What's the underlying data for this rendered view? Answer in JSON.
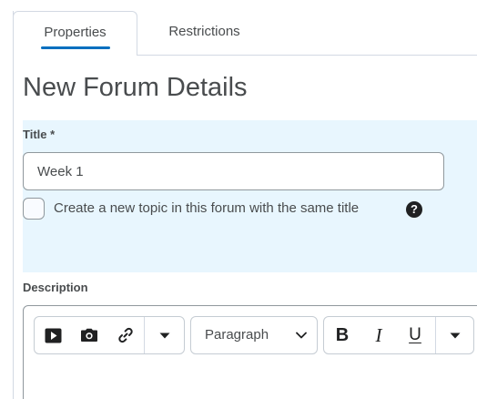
{
  "tabs": [
    {
      "label": "Properties",
      "active": true
    },
    {
      "label": "Restrictions",
      "active": false
    }
  ],
  "page_title": "New Forum Details",
  "title_field": {
    "label": "Title *",
    "value": "Week 1"
  },
  "topic_checkbox": {
    "label": "Create a new topic in this forum with the same title",
    "checked": false,
    "help_icon": "?"
  },
  "description": {
    "label": "Description",
    "toolbar": {
      "media": [
        "play-icon",
        "camera-icon",
        "link-icon",
        "caret-down-icon"
      ],
      "format_label": "Paragraph",
      "style": {
        "bold": "B",
        "italic": "I",
        "underline": "U"
      }
    }
  },
  "colors": {
    "accent": "#006fbf",
    "highlight": "#e8f6fe",
    "text": "#494c4e",
    "border": "#90989d"
  }
}
